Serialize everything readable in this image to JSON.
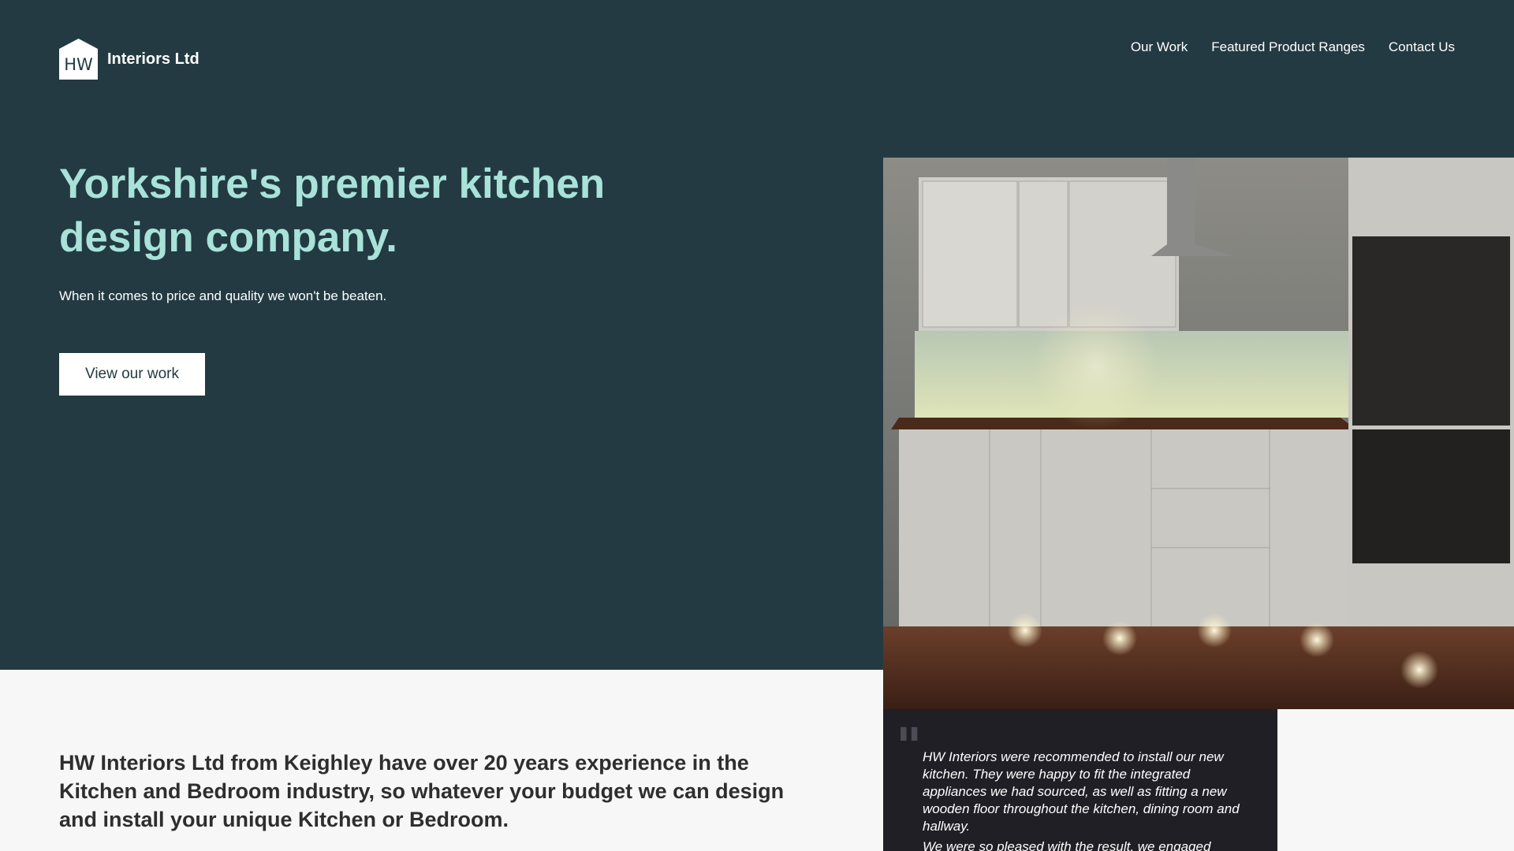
{
  "brand": {
    "logo_letters": "HW",
    "name": "Interiors Ltd"
  },
  "nav": {
    "items": [
      "Our Work",
      "Featured Product Ranges",
      "Contact Us"
    ]
  },
  "hero": {
    "title": "Yorkshire's premier kitchen design company.",
    "subtitle": "When it comes to price and quality we won't be beaten.",
    "cta_label": "View our work"
  },
  "about": {
    "text": "HW Interiors Ltd from Keighley have over 20 years experience in the Kitchen and Bedroom industry, so whatever your budget we can design and install your unique Kitchen or Bedroom."
  },
  "testimonial": {
    "paragraph_1": "HW Interiors were recommended to install our new kitchen. They were happy to fit the integrated appliances we had sourced, as well as fitting a new wooden floor throughout the kitchen, dining room and hallway.",
    "paragraph_2": "We were so pleased with the result, we engaged"
  },
  "colors": {
    "hero_bg": "#233a42",
    "accent": "#a8e2d9",
    "page_bg": "#f7f7f7",
    "quote_bg": "#211f26"
  }
}
